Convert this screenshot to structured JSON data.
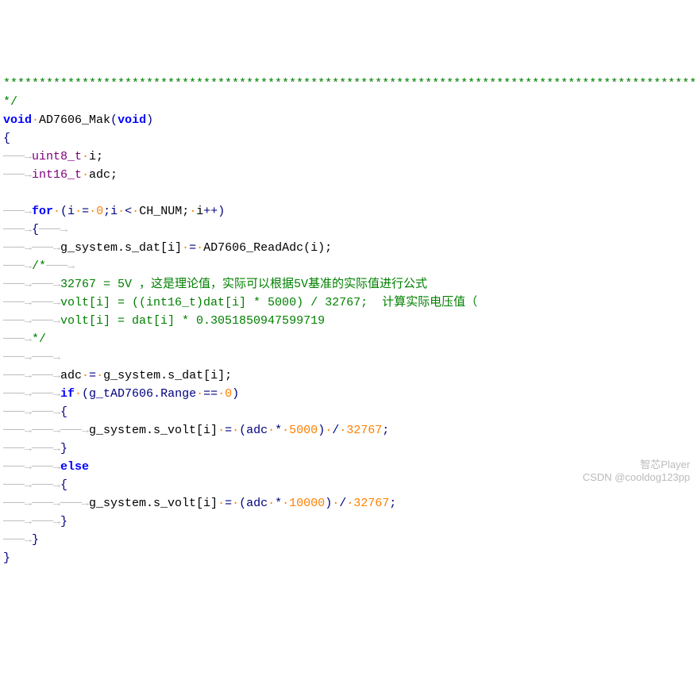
{
  "code": {
    "l0": "**************************************************************************************************************",
    "l1_a": "*/",
    "l2_void": "void",
    "l2_fn": "AD7606_Mak",
    "l2_sig": "(",
    "l2_void2": "void",
    "l2_sigend": ")",
    "l3": "{",
    "l4_type": "uint8_t",
    "l4_var": "i;",
    "l5_type": "int16_t",
    "l5_var": "adc;",
    "l7_for": "for",
    "l7_open": "(i",
    "l7_eq": "=",
    "l7_zero": "0",
    "l7_semi1": ";i",
    "l7_lt": "<",
    "l7_ch": "CH_NUM;",
    "l7_ipp": "i",
    "l7_pp": "++",
    "l7_close": ")",
    "l8_brace": "{",
    "l9_body": "g_system.s_dat[i]",
    "l9_eq": "=",
    "l9_call": "AD7606_ReadAdc(i);",
    "l10_open": "/*",
    "l11": "32767 = 5V ，这是理论值，实际可以根据5V基准的实际值进行公式",
    "l12": "volt[i] = ((int16_t)dat[i] * 5000) / 32767;  计算实际电压值（",
    "l13": "volt[i] = dat[i] * 0.3051850947599719",
    "l14_close": "*/",
    "l16_body": "adc",
    "l16_eq": "=",
    "l16_rhs": "g_system.s_dat[i];",
    "l17_if": "if",
    "l17_cond": "(g_tAD7606.Range",
    "l17_eqeq": "==",
    "l17_zero": "0",
    "l17_close": ")",
    "l18_brace": "{",
    "l19_lhs": "g_system.s_volt[i]",
    "l19_eq": "=",
    "l19_p1": "(adc",
    "l19_mul": "*",
    "l19_5000": "5000",
    "l19_p2": ")",
    "l19_div": "/",
    "l19_32767": "32767",
    "l19_semi": ";",
    "l20_brace": "}",
    "l21_else": "else",
    "l22_brace": "{",
    "l23_lhs": "g_system.s_volt[i]",
    "l23_eq": "=",
    "l23_p1": "(adc",
    "l23_mul": "*",
    "l23_10000": "10000",
    "l23_p2": ")",
    "l23_div": "/",
    "l23_32767": "32767",
    "l23_semi": ";",
    "l24_brace": "}",
    "l25_brace": "}",
    "l26_brace": "}"
  },
  "whitespace": {
    "dot": "·",
    "arrow0": "",
    "arrow1": "───→",
    "arrow2": "───→───→",
    "arrow3": "───→───→───→",
    "arrow4": "───→───→───→───→"
  },
  "watermark": {
    "line1": "智芯Player",
    "line2": "CSDN @cooldog123pp"
  }
}
